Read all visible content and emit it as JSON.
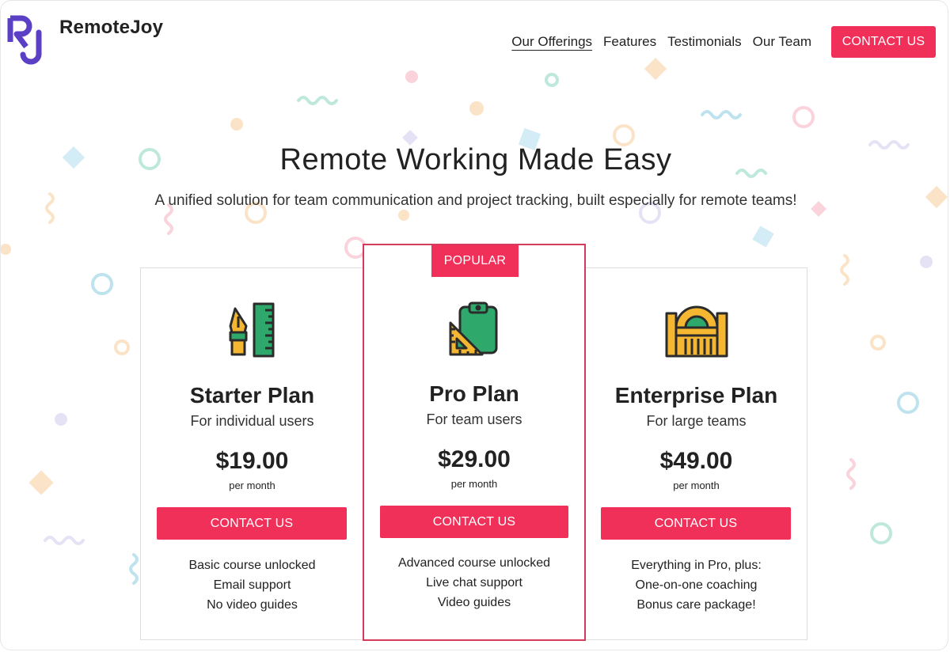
{
  "brand": {
    "logo_letters": "RJ",
    "name": "RemoteJoy",
    "logo_color": "#5b3fc4"
  },
  "nav": {
    "items": [
      {
        "label": "Our Offerings",
        "active": true
      },
      {
        "label": "Features",
        "active": false
      },
      {
        "label": "Testimonials",
        "active": false
      },
      {
        "label": "Our Team",
        "active": false
      }
    ],
    "cta_label": "CONTACT US"
  },
  "hero": {
    "title": "Remote Working Made Easy",
    "subtitle": "A unified solution for team communication and project tracking, built especially for remote teams!"
  },
  "plans": [
    {
      "icon": "pen-ruler-icon",
      "name": "Starter Plan",
      "description": "For individual users",
      "price": "$19.00",
      "period": "per month",
      "cta_label": "CONTACT US",
      "features": [
        "Basic course unlocked",
        "Email support",
        "No video guides"
      ]
    },
    {
      "badge": "POPULAR",
      "icon": "clipboard-set-square-icon",
      "name": "Pro Plan",
      "description": "For team users",
      "price": "$29.00",
      "period": "per month",
      "cta_label": "CONTACT US",
      "features": [
        "Advanced course unlocked",
        "Live chat support",
        "Video guides"
      ]
    },
    {
      "icon": "building-icon",
      "name": "Enterprise Plan",
      "description": "For large teams",
      "price": "$49.00",
      "period": "per month",
      "cta_label": "CONTACT US",
      "features": [
        "Everything in Pro, plus:",
        "One-on-one coaching",
        "Bonus care package!"
      ]
    }
  ],
  "colors": {
    "accent": "#f1305a",
    "popular_border": "#d43a5c",
    "icon_yellow": "#f5b731",
    "icon_green": "#2fa86b",
    "icon_dark": "#2b2b2b"
  }
}
